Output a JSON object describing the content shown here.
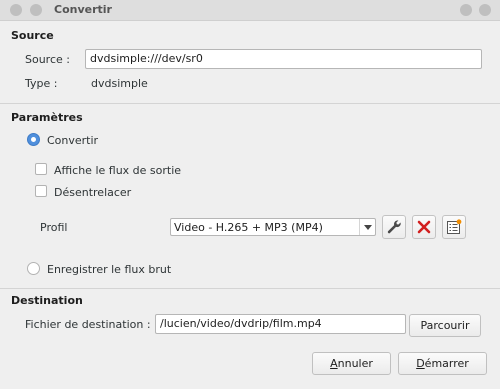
{
  "window": {
    "title": "Convertir"
  },
  "source": {
    "section_title": "Source",
    "label": "Source :",
    "value": "dvdsimple:///dev/sr0",
    "type_label": "Type :",
    "type_value": "dvdsimple"
  },
  "parametres": {
    "section_title": "Paramètres",
    "convert_radio": {
      "label": "Convertir",
      "checked": true
    },
    "show_output_checkbox": {
      "label": "Affiche le flux de sortie",
      "checked": false
    },
    "deinterlace_checkbox": {
      "label": "Désentrelacer",
      "checked": false
    },
    "profile": {
      "label": "Profil",
      "selected": "Video - H.265 + MP3 (MP4)"
    },
    "raw_dump_radio": {
      "label": "Enregistrer le flux brut",
      "checked": false
    }
  },
  "destination": {
    "section_title": "Destination",
    "file_label": "Fichier de destination :",
    "file_value": "/lucien/video/dvdrip/film.mp4",
    "browse_label": "Parcourir"
  },
  "footer": {
    "cancel_first": "A",
    "cancel_rest": "nnuler",
    "start_first": "D",
    "start_rest": "émarrer"
  },
  "colors": {
    "accent": "#4f8fdc",
    "delete_red": "#d21f1f"
  }
}
